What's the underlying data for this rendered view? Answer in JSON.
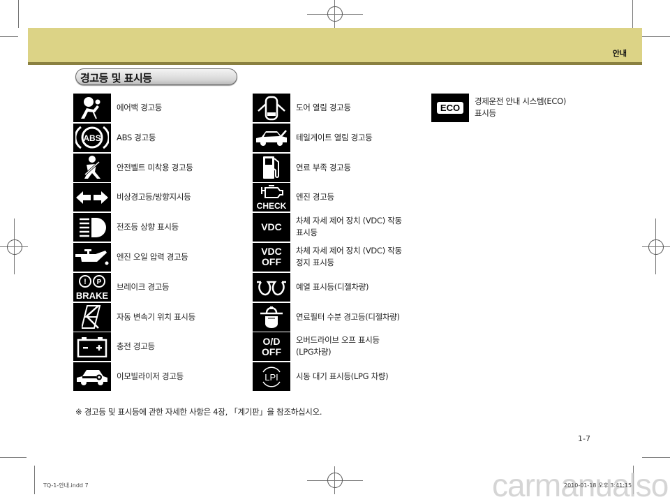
{
  "header": {
    "section": "안내"
  },
  "title": "경고등 및 표시등",
  "columns": [
    [
      {
        "icon": "airbag-icon",
        "label": "에어백 경고등"
      },
      {
        "icon": "abs-icon",
        "icon_text": "ABS",
        "label": "ABS 경고등"
      },
      {
        "icon": "seatbelt-icon",
        "label": "안전벨트 미착용 경고등"
      },
      {
        "icon": "turn-signal-icon",
        "label": "비상경고등/방향지시등"
      },
      {
        "icon": "high-beam-icon",
        "label": "전조등 상향 표시등"
      },
      {
        "icon": "oil-pressure-icon",
        "label": "엔진 오일 압력 경고등"
      },
      {
        "icon": "brake-icon",
        "icon_text": "BRAKE",
        "label": "브레이크 경고등"
      },
      {
        "icon": "gear-position-icon",
        "label": "자동 변속기 위치 표시등"
      },
      {
        "icon": "battery-icon",
        "label": "충전 경고등"
      },
      {
        "icon": "immobilizer-icon",
        "label": "이모빌라이저 경고등"
      }
    ],
    [
      {
        "icon": "door-open-icon",
        "label": "도어  열림 경고등"
      },
      {
        "icon": "tailgate-open-icon",
        "label": "테일게이트 열림 경고등"
      },
      {
        "icon": "fuel-low-icon",
        "label": "연료 부족 경고등"
      },
      {
        "icon": "check-engine-icon",
        "icon_text": "CHECK",
        "label": "엔진 경고등"
      },
      {
        "icon": "vdc-icon",
        "icon_text": "VDC",
        "label": "차체 자세 제어 장치 (VDC) 작동",
        "label2": "표시등"
      },
      {
        "icon": "vdc-off-icon",
        "icon_text": "VDC",
        "icon_text2": "OFF",
        "label": "차체 자세 제어 장치 (VDC) 작동",
        "label2": "정지 표시등"
      },
      {
        "icon": "glow-plug-icon",
        "label": "예열 표시등(디젤차량)"
      },
      {
        "icon": "fuel-filter-water-icon",
        "label": "연료필터 수분 경고등(디젤차량)"
      },
      {
        "icon": "overdrive-off-icon",
        "icon_text": "O/D",
        "icon_text2": "OFF",
        "label": "오버드라이브 오프 표시등",
        "label2": "(LPG차량)"
      },
      {
        "icon": "lpi-icon",
        "icon_text": "LPI",
        "label": "시동 대기 표시등(LPG 차량)"
      }
    ],
    [
      {
        "icon": "eco-icon",
        "icon_text": "ECO",
        "label": "경제운전 안내 시스템(ECO)",
        "label2": "표시등"
      }
    ]
  ],
  "note": "※ 경고등 및 표시등에 관한 자세한 사항은 4장, 「계기판」을 참조하십시오.",
  "page_number": "1-7",
  "slug_left": "TQ-1-안내.indd   7",
  "slug_right": "2010-01-18   오후 3:41:15",
  "watermark": "carmanualsonline.info"
}
